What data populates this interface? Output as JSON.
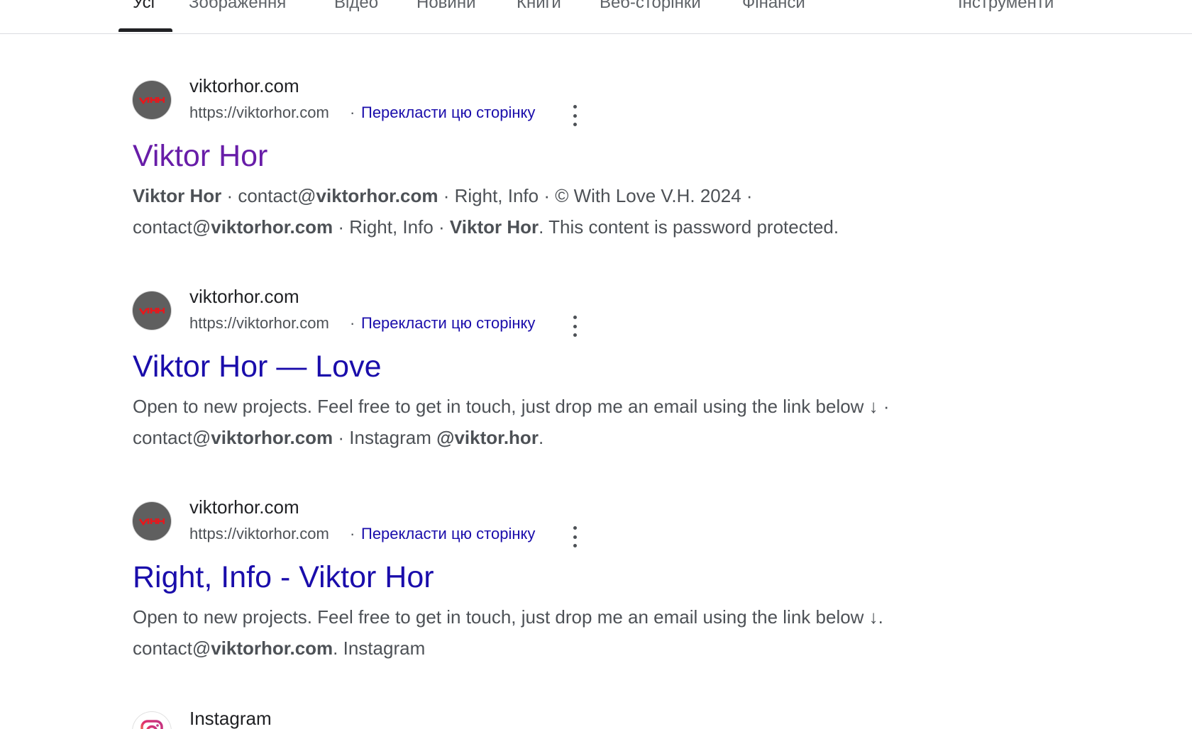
{
  "tabs": [
    {
      "label": "Усі",
      "active": true
    },
    {
      "label": "Зображення"
    },
    {
      "label": "Відео"
    },
    {
      "label": "Новини"
    },
    {
      "label": "Книги"
    },
    {
      "label": "Веб-сторінки"
    },
    {
      "label": "Фінанси"
    }
  ],
  "tools_label": "Інструменти",
  "results": [
    {
      "site_name": "viktorhor.com",
      "url": "https://viktorhor.com",
      "separator": "·",
      "translate": "Перекласти цю сторінку",
      "title": "Viktor Hor",
      "visited": true,
      "snippet_line1": [
        {
          "t": "Viktor Hor",
          "b": true
        },
        {
          "t": " · contact@"
        },
        {
          "t": "viktorhor.com",
          "b": true
        },
        {
          "t": " · Right, Info · © With Love V.H. 2024 ·"
        }
      ],
      "snippet_line2": [
        {
          "t": "contact@"
        },
        {
          "t": "viktorhor.com",
          "b": true
        },
        {
          "t": " · Right, Info · "
        },
        {
          "t": "Viktor Hor",
          "b": true
        },
        {
          "t": ". This content is password protected."
        }
      ]
    },
    {
      "site_name": "viktorhor.com",
      "url": "https://viktorhor.com",
      "separator": "·",
      "translate": "Перекласти цю сторінку",
      "title": "Viktor Hor — Love",
      "visited": false,
      "snippet_line1": [
        {
          "t": "Open to new projects. Feel free to get in touch, just drop me an email using the link below ↓ ·"
        }
      ],
      "snippet_line2": [
        {
          "t": "contact@"
        },
        {
          "t": "viktorhor.com",
          "b": true
        },
        {
          "t": " · Instagram "
        },
        {
          "t": "@viktor.hor",
          "b": true
        },
        {
          "t": "."
        }
      ]
    },
    {
      "site_name": "viktorhor.com",
      "url": "https://viktorhor.com",
      "separator": "·",
      "translate": "Перекласти цю сторінку",
      "title": "Right, Info - Viktor Hor",
      "visited": false,
      "snippet_line1": [
        {
          "t": "Open to new projects. Feel free to get in touch, just drop me an email using the link below ↓."
        }
      ],
      "snippet_line2": [
        {
          "t": "contact@"
        },
        {
          "t": "viktorhor.com",
          "b": true
        },
        {
          "t": ". Instagram"
        }
      ]
    }
  ],
  "partial_result": {
    "site_name": "Instagram"
  },
  "colors": {
    "link": "#1a0dab",
    "visited": "#681da8",
    "snippet": "#4d5156",
    "favicon_bg": "#5f5f5f",
    "favicon_mark": "#e8161b"
  },
  "icons": {
    "favicon": "viktorhor-logo-icon",
    "more": "more-vert-icon",
    "instagram": "instagram-icon"
  }
}
